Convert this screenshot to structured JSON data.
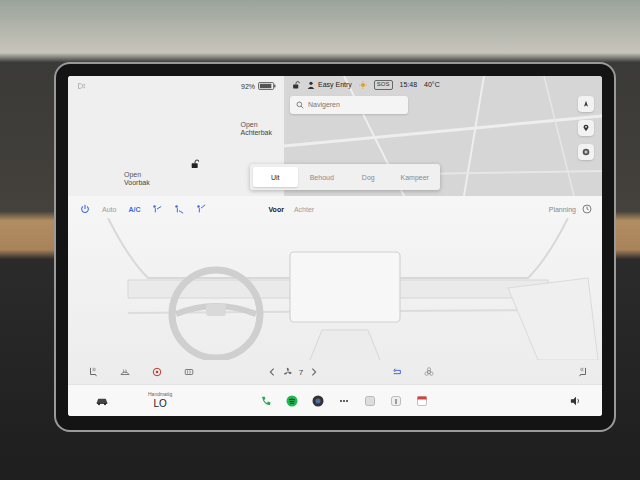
{
  "status": {
    "battery": "92%",
    "battery_level": 0.92,
    "profile": "Easy Entry",
    "sos": "SOS",
    "time": "15:48",
    "temperature": "40°C",
    "locked": false
  },
  "car": {
    "locked": false,
    "frunk": {
      "action": "Open",
      "name": "Voorbak"
    },
    "trunk": {
      "action": "Open",
      "name": "Achterbak"
    }
  },
  "map": {
    "search_placeholder": "Navigeren"
  },
  "climate_modes": [
    {
      "label": "Uit",
      "selected": true
    },
    {
      "label": "Behoud",
      "selected": false
    },
    {
      "label": "Dog",
      "selected": false
    },
    {
      "label": "Kampeer",
      "selected": false
    }
  ],
  "climate": {
    "power_on": true,
    "auto": {
      "label": "Auto",
      "on": false
    },
    "ac": {
      "label": "A/C",
      "on": true
    },
    "zones": [
      {
        "label": "Voor",
        "selected": true
      },
      {
        "label": "Achter",
        "selected": false
      }
    ],
    "schedule": "Planning",
    "fan_speed": "7",
    "recirculate_on": true
  },
  "taskbar": {
    "temp_label": "Handmatig",
    "temp": "LO"
  }
}
